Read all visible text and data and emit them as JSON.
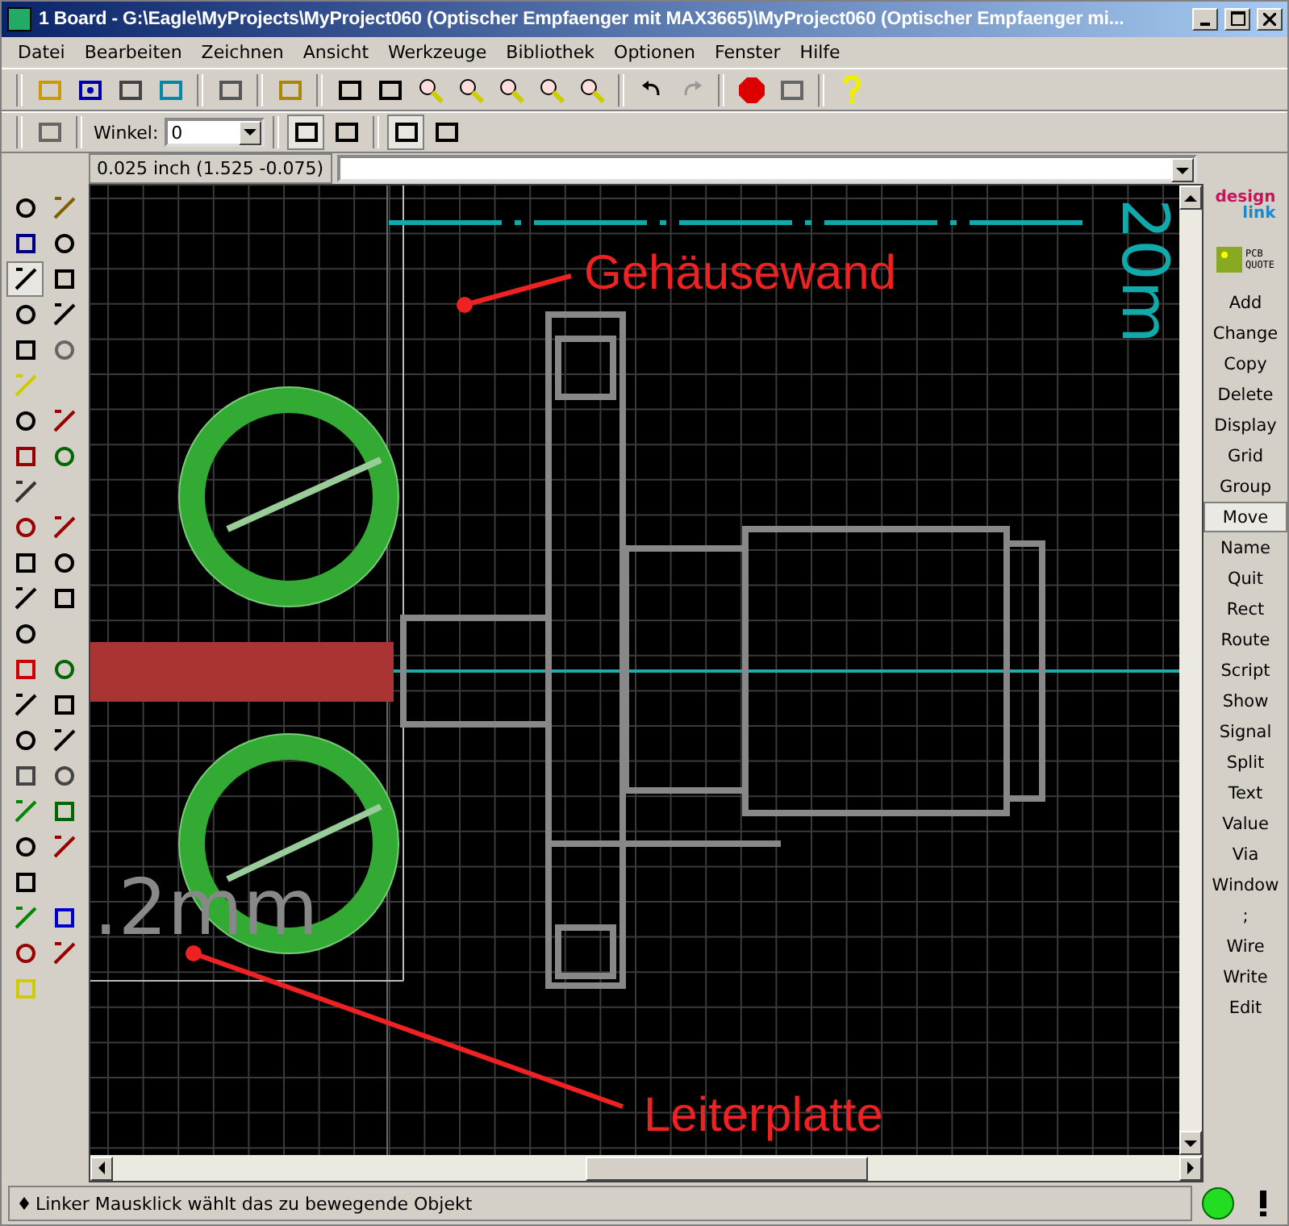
{
  "window": {
    "title": "1 Board - G:\\Eagle\\MyProjects\\MyProject060 (Optischer Empfaenger mit MAX3665)\\MyProject060 (Optischer Empfaenger mi..."
  },
  "menu": [
    "Datei",
    "Bearbeiten",
    "Zeichnen",
    "Ansicht",
    "Werkzeuge",
    "Bibliothek",
    "Optionen",
    "Fenster",
    "Hilfe"
  ],
  "toolbar2": {
    "angle_label": "Winkel:",
    "angle_value": "0"
  },
  "coordinates": "0.025 inch (1.525 -0.075)",
  "logos": {
    "design": "design",
    "link": "link",
    "pcb": "PCB",
    "quote": "QUOTE"
  },
  "commands": [
    {
      "label": "Add",
      "selected": false
    },
    {
      "label": "Change",
      "selected": false
    },
    {
      "label": "Copy",
      "selected": false
    },
    {
      "label": "Delete",
      "selected": false
    },
    {
      "label": "Display",
      "selected": false
    },
    {
      "label": "Grid",
      "selected": false
    },
    {
      "label": "Group",
      "selected": false
    },
    {
      "label": "Move",
      "selected": true
    },
    {
      "label": "Name",
      "selected": false
    },
    {
      "label": "Quit",
      "selected": false
    },
    {
      "label": "Rect",
      "selected": false
    },
    {
      "label": "Route",
      "selected": false
    },
    {
      "label": "Script",
      "selected": false
    },
    {
      "label": "Show",
      "selected": false
    },
    {
      "label": "Signal",
      "selected": false
    },
    {
      "label": "Split",
      "selected": false
    },
    {
      "label": "Text",
      "selected": false
    },
    {
      "label": "Value",
      "selected": false
    },
    {
      "label": "Via",
      "selected": false
    },
    {
      "label": "Window",
      "selected": false
    },
    {
      "label": ";",
      "selected": false
    },
    {
      "label": "Wire",
      "selected": false
    },
    {
      "label": "Write",
      "selected": false
    },
    {
      "label": "Edit",
      "selected": false
    }
  ],
  "canvas": {
    "annotations": [
      "Gehäusewand",
      "Leiterplatte"
    ],
    "dimension_text": ".2mm",
    "dimension_text_top": "20m"
  },
  "status_bar": {
    "message": "Linker Mausklick wählt das zu bewegende Objekt",
    "ready": true
  }
}
